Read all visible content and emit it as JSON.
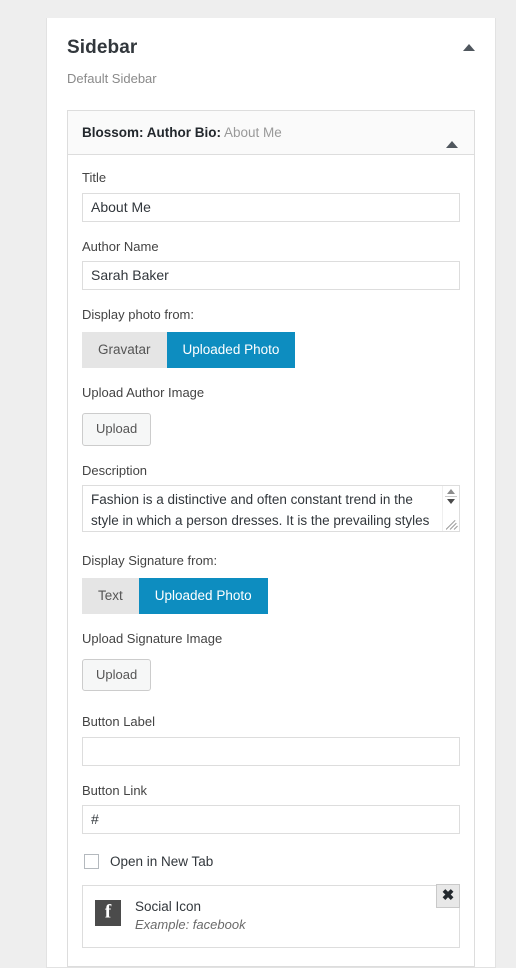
{
  "panel": {
    "title": "Sidebar",
    "subtitle": "Default Sidebar",
    "collapse_icon": "triangle-up-icon"
  },
  "widget": {
    "name": "Blossom: Author Bio:",
    "instance": "About Me",
    "collapse_icon": "triangle-up-icon"
  },
  "form": {
    "title": {
      "label": "Title",
      "value": "About Me",
      "placeholder": ""
    },
    "author_name": {
      "label": "Author Name",
      "value": "Sarah Baker",
      "placeholder": ""
    },
    "display_photo": {
      "label": "Display photo from:",
      "options": [
        "Gravatar",
        "Uploaded Photo"
      ],
      "selected": "Uploaded Photo"
    },
    "upload_author_image": {
      "label": "Upload Author Image",
      "button": "Upload"
    },
    "description": {
      "label": "Description",
      "value": "Fashion is a distinctive and often constant trend in the style in which a person dresses. It is the prevailing styles in",
      "placeholder": ""
    },
    "display_signature": {
      "label": "Display Signature from:",
      "options": [
        "Text",
        "Uploaded Photo"
      ],
      "selected": "Uploaded Photo"
    },
    "upload_signature_image": {
      "label": "Upload Signature Image",
      "button": "Upload"
    },
    "button_label": {
      "label": "Button Label",
      "value": "",
      "placeholder": ""
    },
    "button_link": {
      "label": "Button Link",
      "value": "#",
      "placeholder": ""
    },
    "open_new_tab": {
      "label": "Open in New Tab",
      "checked": false
    },
    "social_icon": {
      "title": "Social Icon",
      "hint": "Example: facebook",
      "icon": "facebook-icon",
      "remove_label": "✖"
    }
  },
  "colors": {
    "accent": "#0d8dc0",
    "inactive": "#e5e5e5",
    "page_bg": "#eeeeee"
  }
}
